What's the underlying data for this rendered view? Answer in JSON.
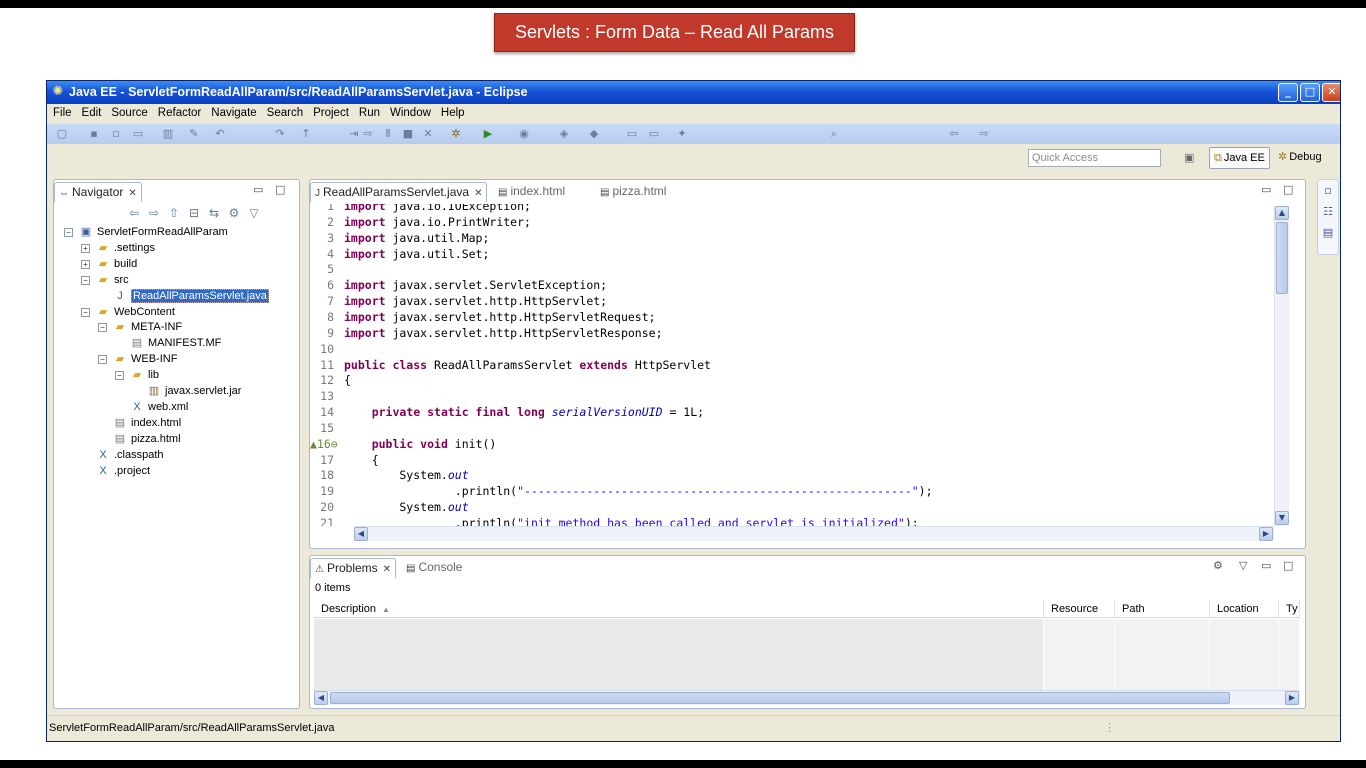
{
  "slide": {
    "banner": "Servlets  : Form Data – Read All Params"
  },
  "window": {
    "title": "Java EE - ServletFormReadAllParam/src/ReadAllParamsServlet.java - Eclipse",
    "buttons": {
      "minimize": "_",
      "maximize": "□",
      "close": "✕"
    }
  },
  "menu": [
    "File",
    "Edit",
    "Source",
    "Refactor",
    "Navigate",
    "Search",
    "Project",
    "Run",
    "Window",
    "Help"
  ],
  "toolbar_icons": [
    "new-icon",
    "save-icon",
    "save-all-icon",
    "print-icon",
    "open-type-icon",
    "toggle-mark-icon",
    "last-edit-icon",
    "next-annotation-icon",
    "prev-annotation-icon",
    "step-into-icon",
    "step-over-icon",
    "suspend-icon",
    "terminate-icon",
    "disconnect-icon",
    "debug-icon",
    "run-icon",
    "external-tools-icon",
    "new-server-icon",
    "new-web-project-icon",
    "open-folder-icon",
    "open-folder-2-icon",
    "new-project-icon",
    "search-icon",
    "back-icon",
    "forward-icon"
  ],
  "perspectives": {
    "quick_access_placeholder": "Quick Access",
    "java_ee": "Java EE",
    "debug": "Debug"
  },
  "navigator": {
    "tab_label": "Navigator",
    "tree": [
      {
        "label": "ServletFormReadAllParam",
        "depth": 0,
        "icon": "project-icon",
        "expander": "−"
      },
      {
        "label": ".settings",
        "depth": 1,
        "icon": "folder-icon",
        "expander": "+"
      },
      {
        "label": "build",
        "depth": 1,
        "icon": "folder-icon",
        "expander": "+"
      },
      {
        "label": "src",
        "depth": 1,
        "icon": "folder-icon",
        "expander": "−"
      },
      {
        "label": "ReadAllParamsServlet.java",
        "depth": 2,
        "icon": "java-file-icon",
        "selected": true
      },
      {
        "label": "WebContent",
        "depth": 1,
        "icon": "folder-icon",
        "expander": "−"
      },
      {
        "label": "META-INF",
        "depth": 2,
        "icon": "folder-icon",
        "expander": "−"
      },
      {
        "label": "MANIFEST.MF",
        "depth": 3,
        "icon": "text-file-icon"
      },
      {
        "label": "WEB-INF",
        "depth": 2,
        "icon": "folder-icon",
        "expander": "−"
      },
      {
        "label": "lib",
        "depth": 3,
        "icon": "folder-icon",
        "expander": "−"
      },
      {
        "label": "javax.servlet.jar",
        "depth": 4,
        "icon": "jar-file-icon"
      },
      {
        "label": "web.xml",
        "depth": 3,
        "icon": "xml-file-icon"
      },
      {
        "label": "index.html",
        "depth": 2,
        "icon": "text-file-icon"
      },
      {
        "label": "pizza.html",
        "depth": 2,
        "icon": "text-file-icon"
      },
      {
        "label": ".classpath",
        "depth": 1,
        "icon": "xml-file-icon"
      },
      {
        "label": ".project",
        "depth": 1,
        "icon": "xml-file-icon"
      }
    ]
  },
  "editor": {
    "tabs": [
      {
        "label": "ReadAllParamsServlet.java",
        "active": true
      },
      {
        "label": "index.html",
        "active": false
      },
      {
        "label": "pizza.html",
        "active": false
      }
    ],
    "lines": [
      {
        "n": "1",
        "parts": [
          [
            "kw",
            "import"
          ],
          [
            "t",
            " java.io.IOException;"
          ]
        ]
      },
      {
        "n": "2",
        "parts": [
          [
            "kw",
            "import"
          ],
          [
            "t",
            " java.io.PrintWriter;"
          ]
        ]
      },
      {
        "n": "3",
        "parts": [
          [
            "kw",
            "import"
          ],
          [
            "t",
            " java.util.Map;"
          ]
        ]
      },
      {
        "n": "4",
        "parts": [
          [
            "kw",
            "import"
          ],
          [
            "t",
            " java.util.Set;"
          ]
        ]
      },
      {
        "n": "5",
        "parts": []
      },
      {
        "n": "6",
        "parts": [
          [
            "kw",
            "import"
          ],
          [
            "t",
            " javax.servlet.ServletException;"
          ]
        ]
      },
      {
        "n": "7",
        "parts": [
          [
            "kw",
            "import"
          ],
          [
            "t",
            " javax.servlet.http.HttpServlet;"
          ]
        ]
      },
      {
        "n": "8",
        "parts": [
          [
            "kw",
            "import"
          ],
          [
            "t",
            " javax.servlet.http.HttpServletRequest;"
          ]
        ]
      },
      {
        "n": "9",
        "parts": [
          [
            "kw",
            "import"
          ],
          [
            "t",
            " javax.servlet.http.HttpServletResponse;"
          ]
        ]
      },
      {
        "n": "10",
        "parts": []
      },
      {
        "n": "11",
        "parts": [
          [
            "kw",
            "public class"
          ],
          [
            "t",
            " ReadAllParamsServlet "
          ],
          [
            "kw",
            "extends"
          ],
          [
            "t",
            " HttpServlet"
          ]
        ]
      },
      {
        "n": "12",
        "parts": [
          [
            "t",
            "{"
          ]
        ]
      },
      {
        "n": "13",
        "parts": []
      },
      {
        "n": "14",
        "parts": [
          [
            "t",
            "    "
          ],
          [
            "kw",
            "private static final long"
          ],
          [
            "t",
            " "
          ],
          [
            "fld",
            "serialVersionUID"
          ],
          [
            "t",
            " = 1L;"
          ]
        ]
      },
      {
        "n": "15",
        "parts": []
      },
      {
        "n": "16",
        "marker": "▲",
        "fold": "⊖",
        "parts": [
          [
            "t",
            "    "
          ],
          [
            "kw",
            "public void"
          ],
          [
            "t",
            " init()"
          ]
        ]
      },
      {
        "n": "17",
        "parts": [
          [
            "t",
            "    {"
          ]
        ]
      },
      {
        "n": "18",
        "parts": [
          [
            "t",
            "        System."
          ],
          [
            "fld",
            "out"
          ]
        ]
      },
      {
        "n": "19",
        "parts": [
          [
            "t",
            "                .println("
          ],
          [
            "str",
            "\"--------------------------------------------------------\""
          ],
          [
            "t",
            ");"
          ]
        ]
      },
      {
        "n": "20",
        "parts": [
          [
            "t",
            "        System."
          ],
          [
            "fld",
            "out"
          ]
        ]
      },
      {
        "n": "21",
        "parts": [
          [
            "t",
            "                .println("
          ],
          [
            "str",
            "\"init method has been called and servlet is initialized\""
          ],
          [
            "t",
            ");"
          ]
        ]
      }
    ]
  },
  "problems": {
    "tab_label": "Problems",
    "console_tab_label": "Console",
    "count": "0 items",
    "columns": [
      "Description",
      "Resource",
      "Path",
      "Location",
      "Ty"
    ],
    "sort_arrow": "▲"
  },
  "status": {
    "text": "ServletFormReadAllParam/src/ReadAllParamsServlet.java"
  }
}
